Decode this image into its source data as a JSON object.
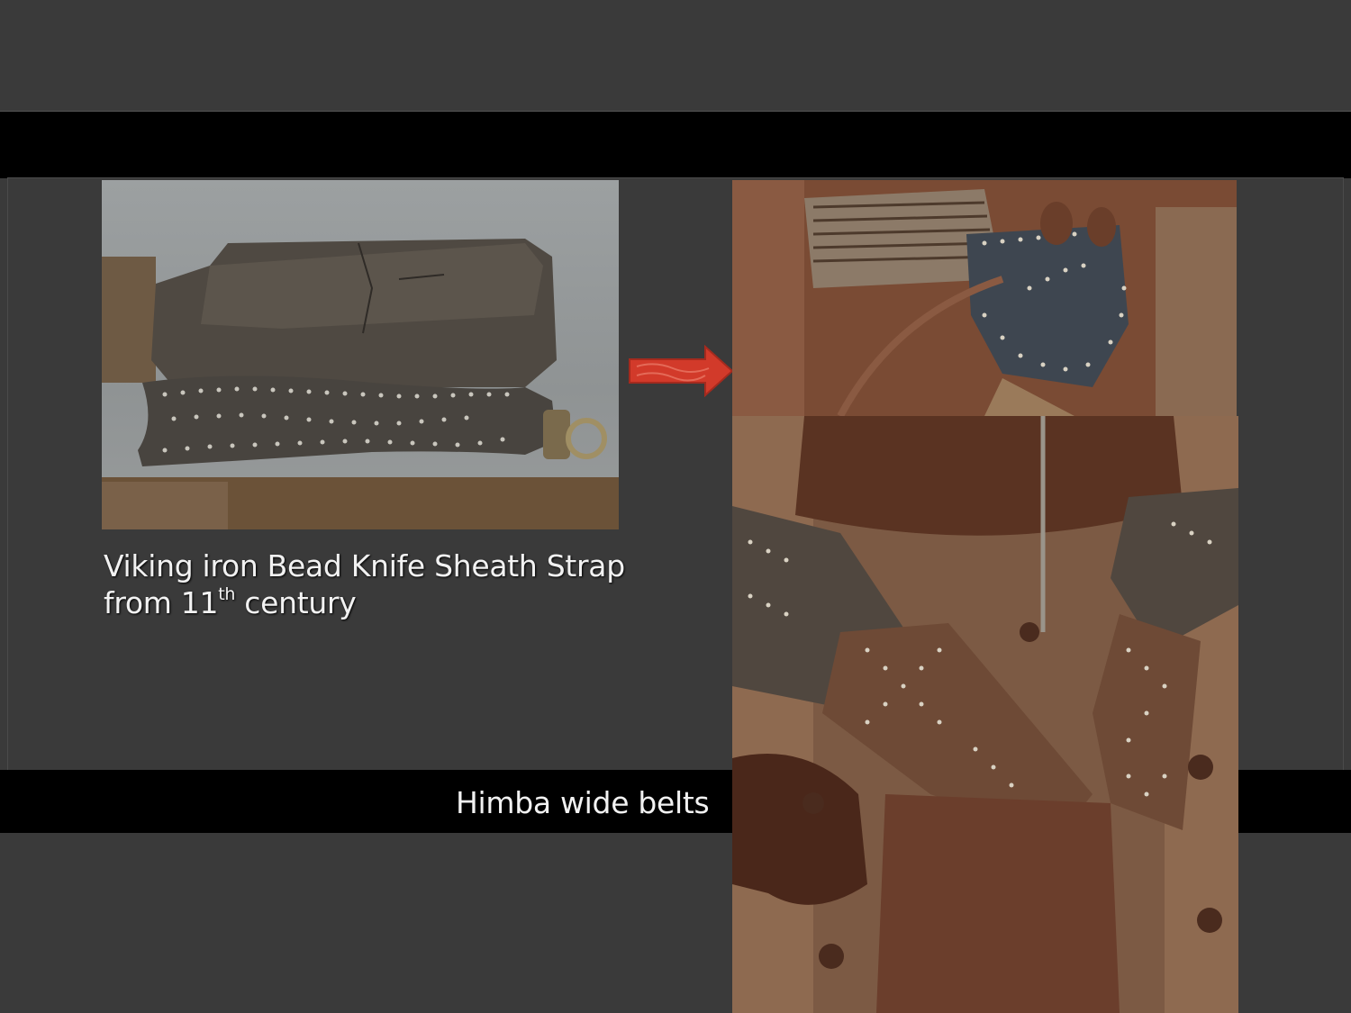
{
  "slide": {
    "background_color": "#3a3a3a",
    "band_color": "#000000",
    "text_color": "#f2f2f2",
    "accent_arrow_color": "#d23a2a"
  },
  "viking": {
    "image_name": "viking-knife-sheath-strap-photo",
    "caption_line1": "Viking iron Bead Knife Sheath Strap",
    "caption_line2_before": "from 11",
    "caption_superscript": "th",
    "caption_line2_after": " century"
  },
  "himba": {
    "image_top_name": "himba-belt-closeup-photo",
    "image_bottom_name": "himba-wide-belt-photo",
    "caption": "Himba wide belts"
  },
  "arrow": {
    "icon": "right-arrow-icon",
    "direction": "right"
  }
}
